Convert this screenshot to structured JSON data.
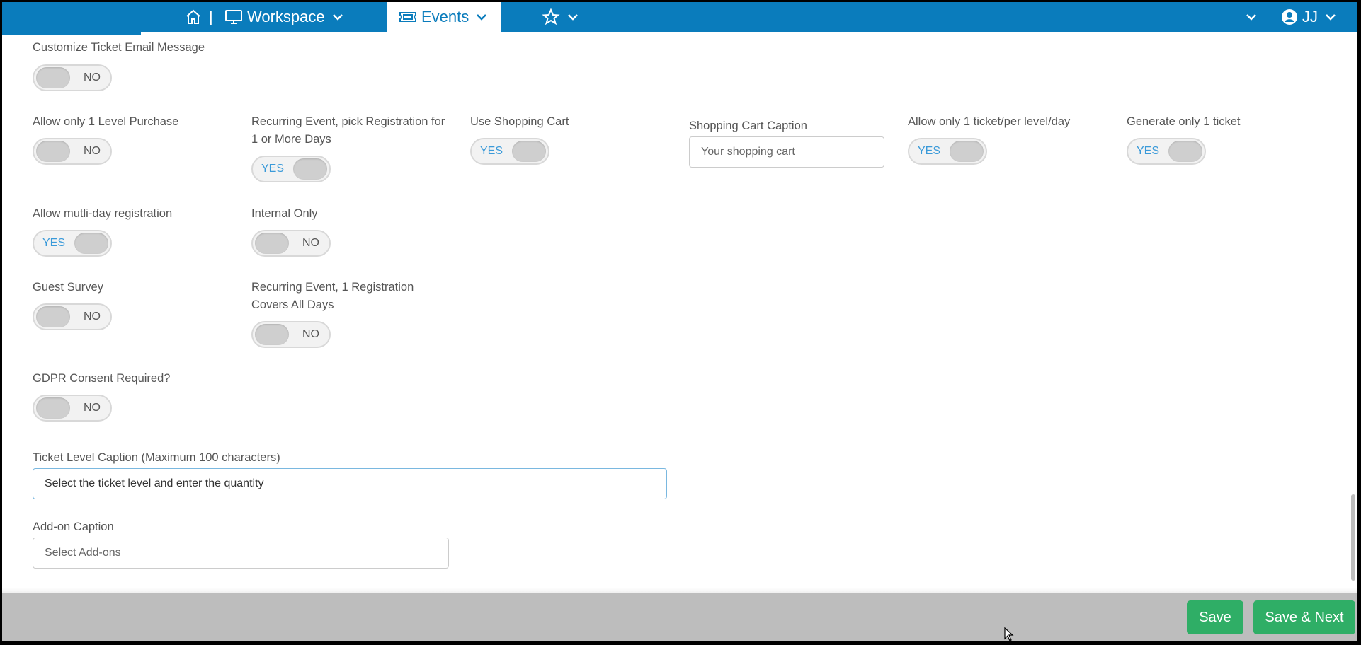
{
  "nav": {
    "workspace_label": "Workspace",
    "separator": "|",
    "events_label": "Events",
    "user_initials": "JJ"
  },
  "fields": {
    "customize_email": {
      "label": "Customize Ticket Email Message",
      "state": "NO"
    },
    "one_level_purchase": {
      "label": "Allow only 1 Level Purchase",
      "state": "NO"
    },
    "recurring_pick": {
      "label_line1": "Recurring Event, pick Registration for",
      "label_line2": "1 or More Days",
      "state": "YES"
    },
    "shopping_cart": {
      "label": "Use Shopping Cart",
      "state": "YES"
    },
    "cart_caption": {
      "label": "Shopping Cart Caption",
      "value": "Your shopping cart"
    },
    "one_ticket_per_day": {
      "label": "Allow only 1 ticket/per level/day",
      "state": "YES"
    },
    "generate_one": {
      "label": "Generate only 1 ticket",
      "state": "YES"
    },
    "multi_day": {
      "label": "Allow mutli-day registration",
      "state": "YES"
    },
    "internal_only": {
      "label": "Internal Only",
      "state": "NO"
    },
    "guest_survey": {
      "label": "Guest Survey",
      "state": "NO"
    },
    "recurring_covers": {
      "label_line1": "Recurring Event, 1 Registration",
      "label_line2": "Covers All Days",
      "state": "NO"
    },
    "gdpr": {
      "label": "GDPR Consent Required?",
      "state": "NO"
    },
    "ticket_caption": {
      "label": "Ticket Level Caption (Maximum 100 characters)",
      "value": "Select the ticket level and enter the quantity"
    },
    "addon_caption": {
      "label": "Add-on Caption",
      "placeholder": "Select Add-ons"
    }
  },
  "footer": {
    "save_label": "Save",
    "save_next_label": "Save & Next"
  },
  "colors": {
    "nav_bg": "#0a7cbc",
    "button_green": "#2fae66",
    "toggle_yes_text": "#3a9ad9"
  }
}
